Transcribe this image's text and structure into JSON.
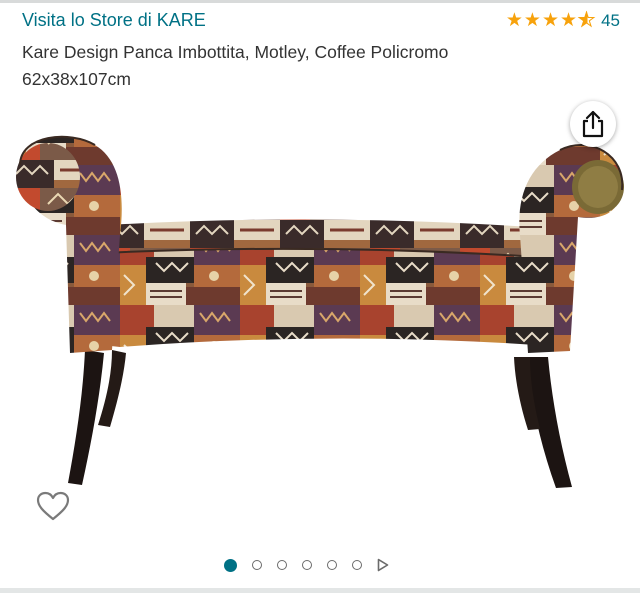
{
  "header": {
    "store_link": "Visita lo Store di KARE",
    "rating": {
      "stars": 4.5,
      "count": "45",
      "icon": "star-icon"
    }
  },
  "product": {
    "title": "Kare Design Panca Imbottita, Motley, Coffee Policromo 62x38x107cm"
  },
  "gallery": {
    "image_count": 6,
    "active_index": 0,
    "share_icon": "share-icon",
    "wishlist_icon": "heart-icon",
    "next_icon": "play-icon"
  },
  "colors": {
    "link": "#007185",
    "star": "#f7a20c",
    "active_dot": "#007185"
  }
}
